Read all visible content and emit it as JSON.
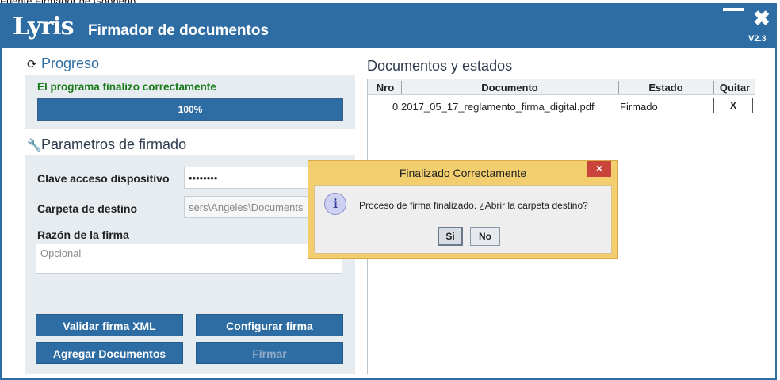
{
  "background_window": {
    "title_fragment": "Fuente Firmador de Gooheno"
  },
  "app": {
    "logo": "Lyris",
    "title": "Firmador de documentos",
    "version": "V2.3",
    "minimize_glyph": "—",
    "close_glyph": "✖"
  },
  "progress": {
    "title": "Progreso",
    "title_icon": "refresh-icon",
    "status": "El programa finalizo correctamente",
    "percent_value": 100,
    "percent_label": "100%"
  },
  "params": {
    "title": "Parametros de firmado",
    "title_icon": "wrench-icon",
    "clave_label": "Clave acceso dispositivo",
    "clave_value": "••••••••",
    "carpeta_label": "Carpeta de destino",
    "carpeta_value": "sers\\Angeles\\Documents",
    "razon_label": "Razón de la firma",
    "razon_placeholder": "Opcional"
  },
  "buttons": {
    "validar": "Validar firma XML",
    "configurar": "Configurar firma",
    "agregar": "Agregar Documentos",
    "firmar": "Firmar"
  },
  "documents": {
    "title": "Documentos y estados",
    "columns": [
      "Nro",
      "Documento",
      "Estado",
      "Quitar"
    ],
    "rows": [
      {
        "nro": "0",
        "documento": "2017_05_17_reglamento_firma_digital.pdf",
        "estado": "Firmado",
        "quitar": "X"
      }
    ]
  },
  "dialog": {
    "title": "Finalizado Correctamente",
    "close_glyph": "×",
    "icon": "info-icon",
    "icon_glyph": "i",
    "message": "Proceso de firma finalizado. ¿Abrir la carpeta destino?",
    "yes": "Si",
    "no": "No"
  },
  "colors": {
    "accent": "#2e6da4",
    "panel_bg": "#e7ecf1",
    "success_text": "#1a7a1a",
    "dialog_frame": "#f3ce6f",
    "dialog_close": "#c9453b"
  }
}
